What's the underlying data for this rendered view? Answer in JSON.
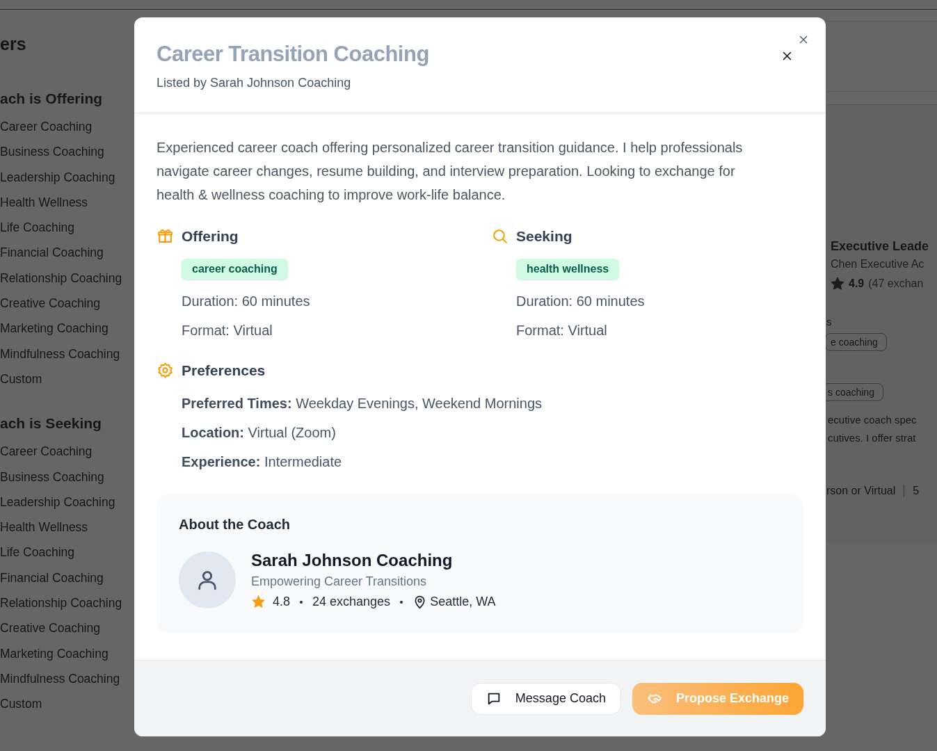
{
  "background": {
    "sidebar": {
      "title": "ers",
      "groups": [
        {
          "heading": "ach is Offering",
          "items": [
            "Career Coaching",
            "Business Coaching",
            "Leadership Coaching",
            "Health Wellness",
            "Life Coaching",
            "Financial Coaching",
            "Relationship Coaching",
            "Creative Coaching",
            "Marketing Coaching",
            "Mindfulness Coaching",
            "Custom"
          ]
        },
        {
          "heading": "ach is Seeking",
          "items": [
            "Career Coaching",
            "Business Coaching",
            "Leadership Coaching",
            "Health Wellness",
            "Life Coaching",
            "Financial Coaching",
            "Relationship Coaching",
            "Creative Coaching",
            "Marketing Coaching",
            "Mindfulness Coaching",
            "Custom"
          ]
        }
      ]
    },
    "card": {
      "title": "Executive Leade",
      "provider": "Chen Executive Ac",
      "rating": "4.9",
      "exchanges": "(47 exchan",
      "section_label": "s",
      "offering_tag": "e coaching",
      "seeking_tag": "s coaching",
      "description": [
        "ecutive coach spec",
        "cutives. I offer strat"
      ],
      "format": "rson or Virtual",
      "duration": "5"
    }
  },
  "modal": {
    "title": "Career Transition Coaching",
    "subtitle": "Listed by Sarah Johnson Coaching",
    "description": "Experienced career coach offering personalized career transition guidance. I help professionals navigate career changes, resume building, and interview preparation. Looking to exchange for health & wellness coaching to improve work-life balance.",
    "sections": [
      {
        "kind": "offering",
        "heading": "Offering",
        "tag": "career coaching",
        "lines": [
          "Duration: 60 minutes",
          "Format: Virtual"
        ]
      },
      {
        "kind": "seeking",
        "heading": "Seeking",
        "tag": "health wellness",
        "lines": [
          "Duration: 60 minutes",
          "Format: Virtual"
        ]
      }
    ],
    "preferences": {
      "heading": "Preferences",
      "lines": [
        "**Preferred Times:** Weekday Evenings, Weekend Mornings",
        "**Location:** Virtual (Zoom)",
        "**Experience:** Intermediate"
      ]
    },
    "coach": {
      "heading": "About the Coach",
      "name": "Sarah Johnson Coaching",
      "tagline": "Empowering Career Transitions",
      "rating": "4.8",
      "exchanges": "24 exchanges",
      "location": "Seattle, WA"
    },
    "buttons": [
      {
        "kind": "secondary",
        "label": "Message Coach"
      },
      {
        "kind": "primary",
        "label": "Propose Exchange"
      }
    ]
  }
}
